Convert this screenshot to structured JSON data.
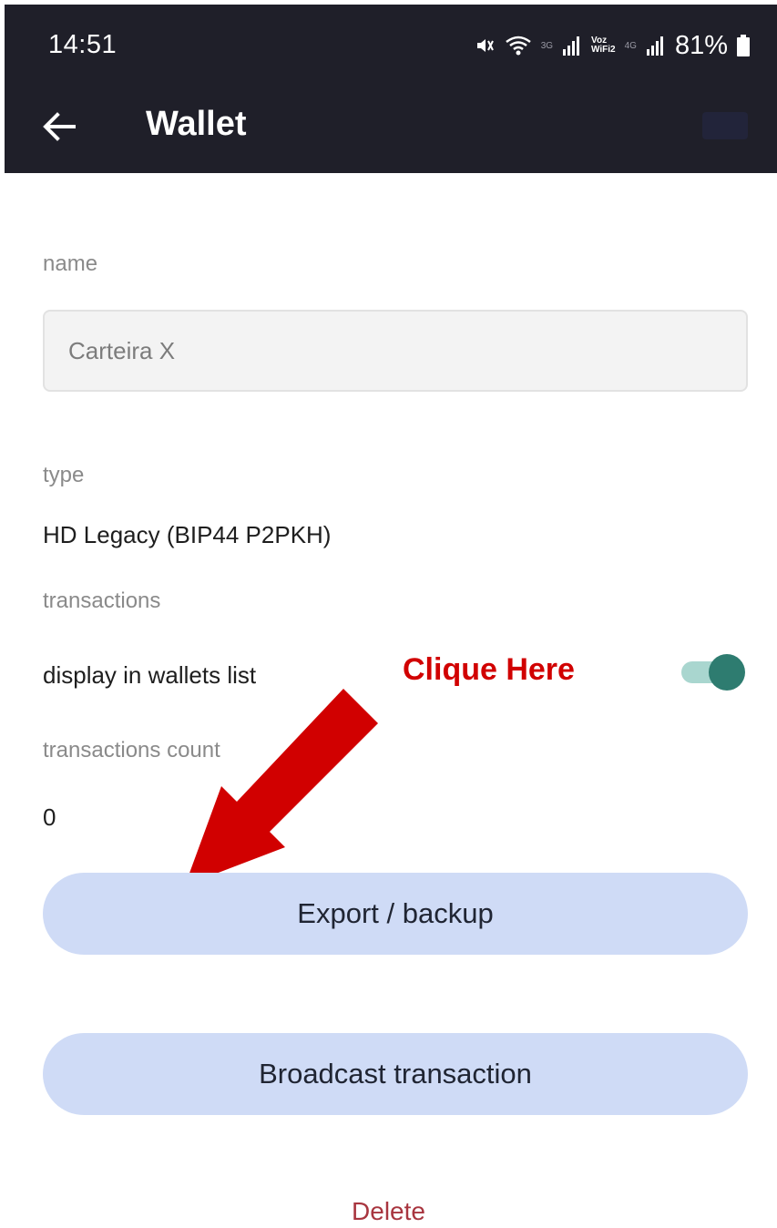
{
  "status_bar": {
    "time": "14:51",
    "net_3g": "3G",
    "voz_top": "Voz",
    "voz_bottom": "WiFi2",
    "net_4g": "4G",
    "battery": "81%"
  },
  "header": {
    "title": "Wallet",
    "back_icon": "arrow-left-icon"
  },
  "form": {
    "name_label": "name",
    "name_value": "Carteira X",
    "type_label": "type",
    "type_value": "HD Legacy (BIP44 P2PKH)",
    "transactions_label": "transactions",
    "display_label": "display in wallets list",
    "display_enabled": true,
    "tx_count_label": "transactions count",
    "tx_count_value": "0"
  },
  "annotation": {
    "text": "Clique Here",
    "color": "#d10000"
  },
  "buttons": {
    "export_label": "Export / backup",
    "broadcast_label": "Broadcast transaction",
    "delete_label": "Delete"
  },
  "colors": {
    "header_bg": "#1f1f29",
    "button_bg": "#cfdbf6",
    "toggle_on": "#2e7c70",
    "delete": "#a8353f"
  }
}
